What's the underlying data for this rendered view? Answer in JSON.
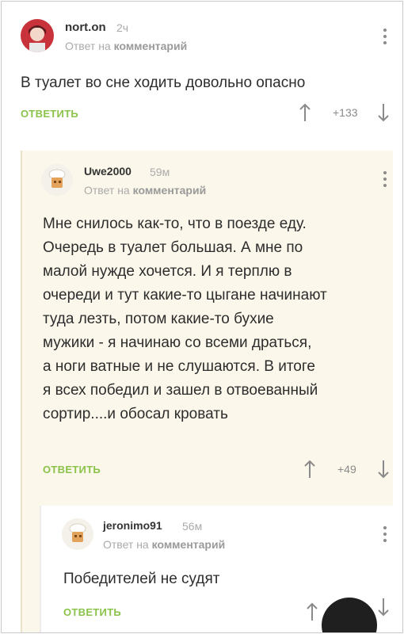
{
  "comments": [
    {
      "username": "nort.on",
      "time": "2ч",
      "reply_prefix": "Ответ на",
      "reply_target": "комментарий",
      "text": "В туалет во сне ходить довольно опасно",
      "reply_label": "ОТВЕТИТЬ",
      "rating": "+133"
    },
    {
      "username": "Uwe2000",
      "time": "59м",
      "reply_prefix": "Ответ на",
      "reply_target": "комментарий",
      "text_lines": [
        "Мне снилось как-то, что в поезде еду.",
        "Очередь в туалет большая. А мне по",
        "малой нужде хочется.  И я терплю в",
        "очереди и тут какие-то цыгане начинают",
        "туда лезть, потом какие-то бухие",
        "мужики - я начинаю со всеми драться,",
        "а ноги ватные и не слушаются. В итоге",
        "я всех победил и зашел в отвоеванный",
        "сортир....и обосал кровать"
      ],
      "reply_label": "ОТВЕТИТЬ",
      "rating": "+49"
    },
    {
      "username": "jeronimo91",
      "time": "56м",
      "reply_prefix": "Ответ на",
      "reply_target": "комментарий",
      "text": "Победителей не судят",
      "reply_label": "ОТВЕТИТЬ"
    }
  ],
  "colors": {
    "accent": "#8bc34a",
    "nested_bg": "#fbf7ea"
  }
}
